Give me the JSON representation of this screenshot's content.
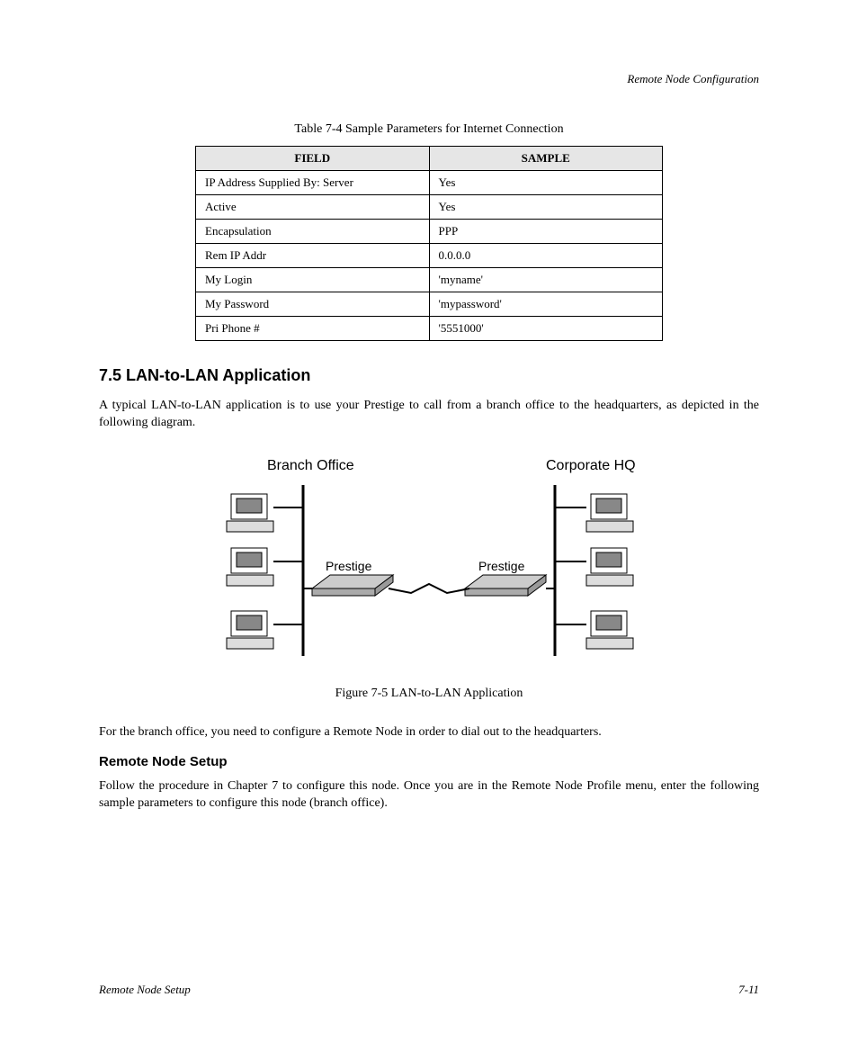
{
  "header": {
    "right": "Remote Node Configuration"
  },
  "table": {
    "caption": "Table 7-4 Sample Parameters for Internet Connection",
    "headers": [
      "FIELD",
      "SAMPLE"
    ],
    "rows": [
      [
        "IP Address Supplied By: Server",
        "Yes"
      ],
      [
        "Active",
        "Yes"
      ],
      [
        "Encapsulation",
        "PPP"
      ],
      [
        "Rem IP Addr",
        "0.0.0.0"
      ],
      [
        "My Login",
        "'myname'"
      ],
      [
        "My Password",
        "'mypassword'"
      ],
      [
        "Pri Phone #",
        "'5551000'"
      ]
    ]
  },
  "section": {
    "heading": "7.5  LAN-to-LAN Application",
    "para1": "A typical LAN-to-LAN application is to use your Prestige to call from a branch office to the headquarters, as depicted in the following diagram.",
    "figure_caption": "Figure 7-5 LAN-to-LAN Application",
    "para2": "For the branch office, you need to configure a Remote Node in order to dial out to the headquarters.",
    "subheading": "Remote Node Setup",
    "para3": "Follow the procedure in Chapter 7 to configure this node. Once you are in the Remote Node Profile menu, enter the following sample parameters to configure this node (branch office)."
  },
  "figure": {
    "branch_label": "Branch Office",
    "hq_label": "Corporate HQ",
    "device_label": "Prestige"
  },
  "footer": {
    "left": "Remote Node Setup",
    "right": "7-11"
  }
}
